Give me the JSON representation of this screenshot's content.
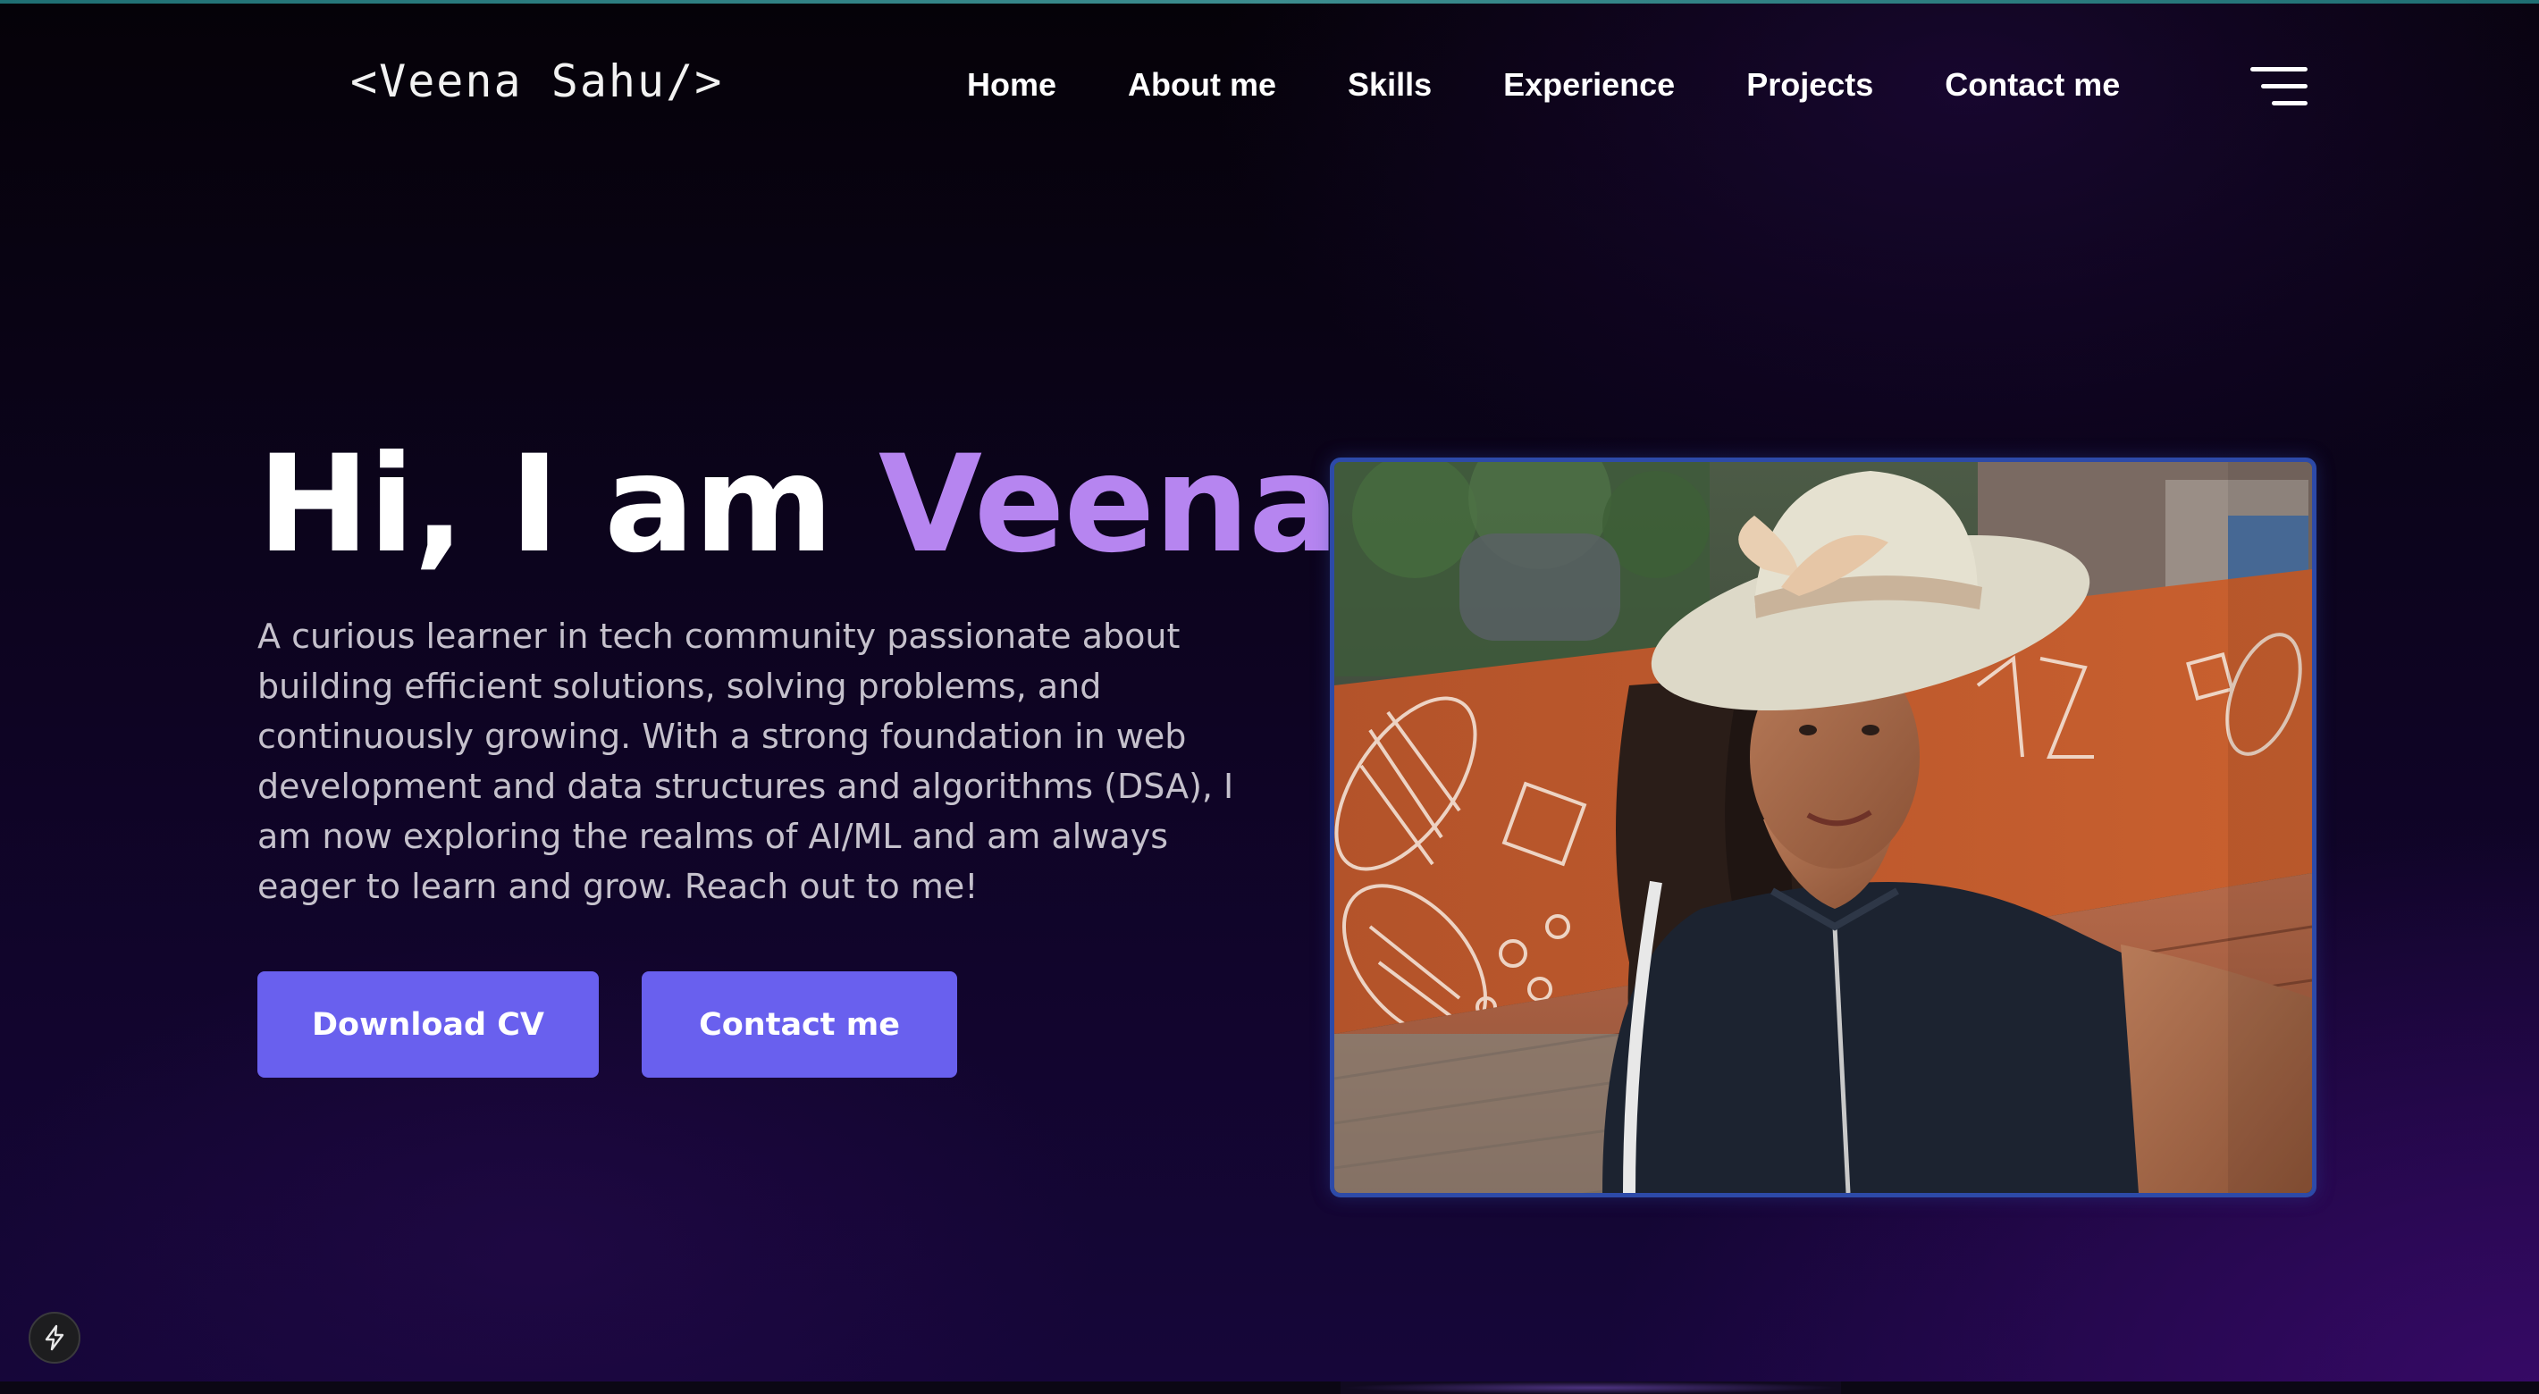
{
  "header": {
    "logo": "<Veena Sahu/>",
    "nav": [
      {
        "label": "Home"
      },
      {
        "label": "About me"
      },
      {
        "label": "Skills"
      },
      {
        "label": "Experience"
      },
      {
        "label": "Projects"
      },
      {
        "label": "Contact me"
      }
    ],
    "menu_icon": "hamburger-menu-icon"
  },
  "hero": {
    "title_prefix": "Hi, I am",
    "title_name": "Veena",
    "description": "A curious learner in tech community passionate about building efficient solutions, solving problems, and continuously growing. With a strong foundation in web development and data structures and algorithms (DSA), I am now exploring the realms of AI/ML and am always eager to learn and grow. Reach out to me!",
    "buttons": {
      "download_cv": "Download CV",
      "contact": "Contact me"
    },
    "photo_icon": "profile-photo"
  },
  "badge_icon": "lightning-bolt-icon",
  "colors": {
    "accent_name": "#b685f0",
    "button": "#6960ee",
    "photo_border": "#2d4aa8",
    "description_text": "#c5c1cc"
  }
}
